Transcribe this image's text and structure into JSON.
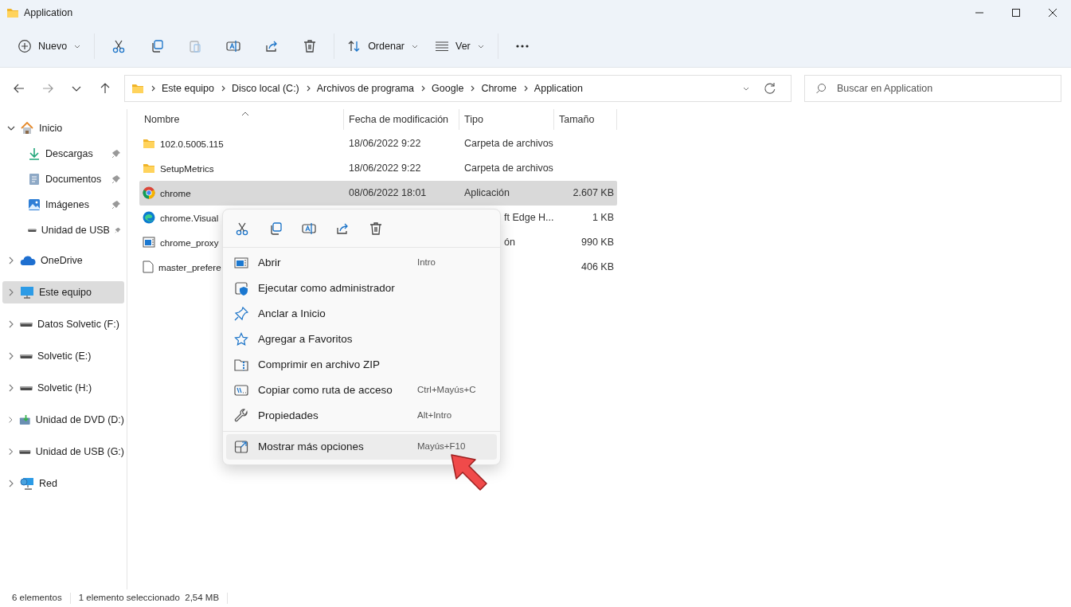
{
  "window": {
    "title": "Application"
  },
  "toolbar": [
    {
      "kind": "new",
      "label": "Nuevo",
      "disabled": false
    },
    {
      "kind": "cut",
      "disabled": false
    },
    {
      "kind": "copy",
      "disabled": false
    },
    {
      "kind": "paste",
      "disabled": true
    },
    {
      "kind": "rename",
      "disabled": false
    },
    {
      "kind": "share",
      "disabled": false
    },
    {
      "kind": "delete",
      "disabled": false
    },
    {
      "kind": "sort",
      "label": "Ordenar",
      "disabled": false
    },
    {
      "kind": "view",
      "label": "Ver",
      "disabled": false
    },
    {
      "kind": "more",
      "disabled": false
    }
  ],
  "address": {
    "crumbs": [
      "Este equipo",
      "Disco local (C:)",
      "Archivos de programa",
      "Google",
      "Chrome",
      "Application"
    ]
  },
  "search": {
    "placeholder": "Buscar en Application"
  },
  "sidebar": {
    "items": [
      {
        "label": "Inicio",
        "kind": "home",
        "expanded": true,
        "selected": false,
        "children": [
          {
            "label": "Descargas",
            "kind": "download",
            "pinned": true,
            "selected": false
          },
          {
            "label": "Documentos",
            "kind": "document",
            "pinned": true,
            "selected": false
          },
          {
            "label": "Imágenes",
            "kind": "image",
            "pinned": true,
            "selected": false
          },
          {
            "label": "Unidad de USB",
            "kind": "drive",
            "pinned": true,
            "selected": false
          }
        ]
      },
      {
        "label": "OneDrive",
        "kind": "cloud",
        "expanded": false,
        "selected": false
      },
      {
        "label": "Este equipo",
        "kind": "pc",
        "expanded": false,
        "selected": true
      },
      {
        "label": "Datos Solvetic (F:)",
        "kind": "drive",
        "expanded": false,
        "selected": false
      },
      {
        "label": "Solvetic (E:)",
        "kind": "drive",
        "expanded": false,
        "selected": false
      },
      {
        "label": "Solvetic (H:)",
        "kind": "drive",
        "expanded": false,
        "selected": false
      },
      {
        "label": "Unidad de DVD (D:)",
        "kind": "dvd",
        "expanded": false,
        "selected": false
      },
      {
        "label": "Unidad de USB (G:)",
        "kind": "drive",
        "expanded": false,
        "selected": false
      },
      {
        "label": "Red",
        "kind": "network",
        "expanded": false,
        "selected": false
      }
    ]
  },
  "table": {
    "columns": [
      "Nombre",
      "Fecha de modificación",
      "Tipo",
      "Tamaño"
    ],
    "rows": [
      {
        "kind": "folder",
        "name": "102.0.5005.115",
        "date": "18/06/2022 9:22",
        "type": "Carpeta de archivos",
        "selected": false
      },
      {
        "kind": "folder",
        "name": "SetupMetrics",
        "date": "18/06/2022 9:22",
        "type": "Carpeta de archivos",
        "selected": false
      },
      {
        "kind": "chrome",
        "name": "chrome",
        "date": "08/06/2022 18:01",
        "type": "Aplicación",
        "size": "2.607 KB",
        "selected": true
      },
      {
        "kind": "edge",
        "name": "chrome.Visual",
        "type": "ft Edge H...",
        "size": "1 KB",
        "selected": false
      },
      {
        "kind": "app",
        "name": "chrome_proxy",
        "type": "ón",
        "size": "990 KB",
        "selected": false
      },
      {
        "kind": "file",
        "name": "master_prefere",
        "size": "406 KB",
        "selected": false
      }
    ]
  },
  "context_menu": {
    "actions": [
      {
        "kind": "cut"
      },
      {
        "kind": "copy"
      },
      {
        "kind": "rename"
      },
      {
        "kind": "share"
      },
      {
        "kind": "delete"
      }
    ],
    "items": [
      {
        "kind": "open",
        "label": "Abrir",
        "shortcut": "Intro",
        "highlighted": false
      },
      {
        "kind": "admin",
        "label": "Ejecutar como administrador",
        "highlighted": false
      },
      {
        "kind": "pin",
        "label": "Anclar a Inicio",
        "highlighted": false
      },
      {
        "kind": "star",
        "label": "Agregar a Favoritos",
        "highlighted": false
      },
      {
        "kind": "zip",
        "label": "Comprimir en archivo ZIP",
        "highlighted": false
      },
      {
        "kind": "path",
        "label": "Copiar como ruta de acceso",
        "shortcut": "Ctrl+Mayús+C",
        "highlighted": false
      },
      {
        "kind": "wrench",
        "label": "Propiedades",
        "shortcut": "Alt+Intro",
        "highlighted": false
      },
      {
        "kind": "moreopt",
        "label": "Mostrar más opciones",
        "shortcut": "Mayús+F10",
        "highlighted": true
      }
    ]
  },
  "status_bar": [
    "6 elementos",
    "1 elemento seleccionado  2,54 MB"
  ]
}
